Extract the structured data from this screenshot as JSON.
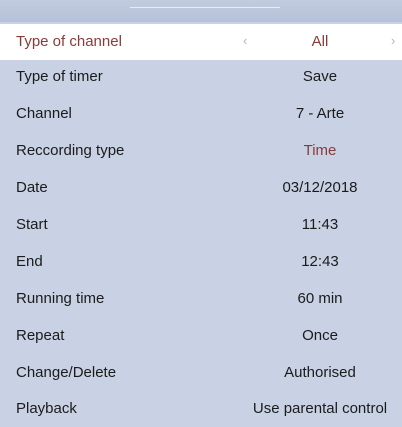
{
  "rows": [
    {
      "label": "Type of channel",
      "value": "All"
    },
    {
      "label": "Type of timer",
      "value": "Save"
    },
    {
      "label": "Channel",
      "value": "7 - Arte"
    },
    {
      "label": "Reccording type",
      "value": "Time"
    },
    {
      "label": "Date",
      "value": "03/12/2018"
    },
    {
      "label": "Start",
      "value": "11:43"
    },
    {
      "label": "End",
      "value": "12:43"
    },
    {
      "label": "Running time",
      "value": "60 min"
    },
    {
      "label": "Repeat",
      "value": "Once"
    },
    {
      "label": "Change/Delete",
      "value": "Authorised"
    },
    {
      "label": "Playback",
      "value": "Use parental control"
    }
  ],
  "selector_arrows": {
    "left": "‹",
    "right": "›"
  },
  "colors": {
    "background": "#c8d2e4",
    "selected_row": "#ffffff",
    "accent_text": "#8b3a3a",
    "text": "#1b1b1b"
  }
}
